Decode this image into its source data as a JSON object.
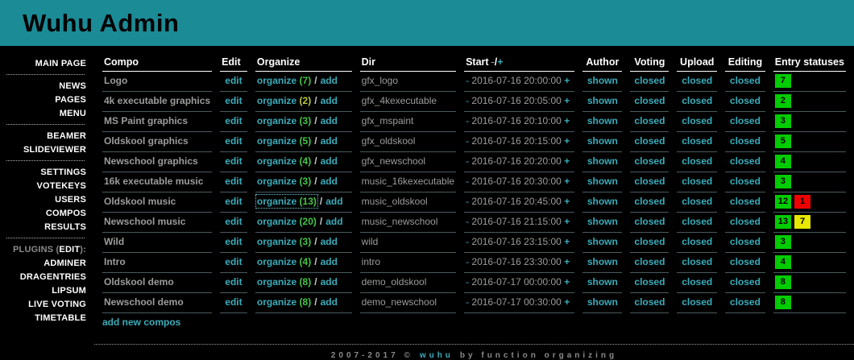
{
  "header": {
    "title": "Wuhu Admin"
  },
  "colors": {
    "header_bg": "#1b8b96",
    "link_teal": "#3aacba",
    "count_green": "#44c544",
    "count_yellow": "#b9c83a",
    "badge_green": "#00cc00",
    "badge_red": "#ee0000",
    "badge_yellow": "#e8e800"
  },
  "sidebar": {
    "items": [
      "MAIN PAGE",
      "NEWS",
      "PAGES",
      "MENU",
      "BEAMER",
      "SLIDEVIEWER",
      "SETTINGS",
      "VOTEKEYS",
      "USERS",
      "COMPOS",
      "RESULTS",
      "ADMINER",
      "DRAGENTRIES",
      "LIPSUM",
      "LIVE VOTING",
      "TIMETABLE"
    ],
    "plugins_prefix": "PLUGINS (",
    "plugins_edit": "EDIT",
    "plugins_suffix": "):"
  },
  "labels": {
    "edit": "edit",
    "organize": "organize",
    "add": "add",
    "slash": "/",
    "minus": "-",
    "plus": "+"
  },
  "table": {
    "headers": {
      "compo": "Compo",
      "edit": "Edit",
      "organize": "Organize",
      "dir": "Dir",
      "start": "Start",
      "start_minus": "-",
      "start_slash": "/",
      "start_plus": "+",
      "author": "Author",
      "voting": "Voting",
      "upload": "Upload",
      "editing": "Editing",
      "entry_statuses": "Entry statuses"
    },
    "add_new": "add new compos",
    "rows": [
      {
        "compo": "Logo",
        "count": "(7)",
        "count_color": "#44c544",
        "dir": "gfx_logo",
        "start": "2016-07-16 20:00:00",
        "author": "shown",
        "voting": "closed",
        "upload": "closed",
        "editing": "closed",
        "badges": [
          {
            "value": "7",
            "color": "#00cc00"
          }
        ]
      },
      {
        "compo": "4k executable graphics",
        "count": "(2)",
        "count_color": "#b9c83a",
        "dir": "gfx_4kexecutable",
        "start": "2016-07-16 20:05:00",
        "author": "shown",
        "voting": "closed",
        "upload": "closed",
        "editing": "closed",
        "badges": [
          {
            "value": "2",
            "color": "#00cc00"
          }
        ]
      },
      {
        "compo": "MS Paint graphics",
        "count": "(3)",
        "count_color": "#44c544",
        "dir": "gfx_mspaint",
        "start": "2016-07-16 20:10:00",
        "author": "shown",
        "voting": "closed",
        "upload": "closed",
        "editing": "closed",
        "badges": [
          {
            "value": "3",
            "color": "#00cc00"
          }
        ]
      },
      {
        "compo": "Oldskool graphics",
        "count": "(5)",
        "count_color": "#44c544",
        "dir": "gfx_oldskool",
        "start": "2016-07-16 20:15:00",
        "author": "shown",
        "voting": "closed",
        "upload": "closed",
        "editing": "closed",
        "badges": [
          {
            "value": "5",
            "color": "#00cc00"
          }
        ]
      },
      {
        "compo": "Newschool graphics",
        "count": "(4)",
        "count_color": "#44c544",
        "dir": "gfx_newschool",
        "start": "2016-07-16 20:20:00",
        "author": "shown",
        "voting": "closed",
        "upload": "closed",
        "editing": "closed",
        "badges": [
          {
            "value": "4",
            "color": "#00cc00"
          }
        ]
      },
      {
        "compo": "16k executable music",
        "count": "(3)",
        "count_color": "#44c544",
        "dir": "music_16kexecutable",
        "start": "2016-07-16 20:30:00",
        "author": "shown",
        "voting": "closed",
        "upload": "closed",
        "editing": "closed",
        "badges": [
          {
            "value": "3",
            "color": "#00cc00"
          }
        ]
      },
      {
        "compo": "Oldskool music",
        "count": "(13)",
        "count_color": "#44c544",
        "organize_focused": true,
        "dir": "music_oldskool",
        "start": "2016-07-16 20:45:00",
        "author": "shown",
        "voting": "closed",
        "upload": "closed",
        "editing": "closed",
        "badges": [
          {
            "value": "12",
            "color": "#00cc00"
          },
          {
            "value": "1",
            "color": "#ee0000"
          }
        ]
      },
      {
        "compo": "Newschool music",
        "count": "(20)",
        "count_color": "#44c544",
        "dir": "music_newschool",
        "start": "2016-07-16 21:15:00",
        "author": "shown",
        "voting": "closed",
        "upload": "closed",
        "editing": "closed",
        "badges": [
          {
            "value": "13",
            "color": "#00cc00"
          },
          {
            "value": "7",
            "color": "#e8e800"
          }
        ]
      },
      {
        "compo": "Wild",
        "count": "(3)",
        "count_color": "#44c544",
        "dir": "wild",
        "start": "2016-07-16 23:15:00",
        "author": "shown",
        "voting": "closed",
        "upload": "closed",
        "editing": "closed",
        "badges": [
          {
            "value": "3",
            "color": "#00cc00"
          }
        ]
      },
      {
        "compo": "Intro",
        "count": "(4)",
        "count_color": "#44c544",
        "dir": "intro",
        "start": "2016-07-16 23:30:00",
        "author": "shown",
        "voting": "closed",
        "upload": "closed",
        "editing": "closed",
        "badges": [
          {
            "value": "4",
            "color": "#00cc00"
          }
        ]
      },
      {
        "compo": "Oldskool demo",
        "count": "(8)",
        "count_color": "#44c544",
        "dir": "demo_oldskool",
        "start": "2016-07-17 00:00:00",
        "author": "shown",
        "voting": "closed",
        "upload": "closed",
        "editing": "closed",
        "badges": [
          {
            "value": "8",
            "color": "#00cc00"
          }
        ]
      },
      {
        "compo": "Newschool demo",
        "count": "(8)",
        "count_color": "#44c544",
        "dir": "demo_newschool",
        "start": "2016-07-17 00:30:00",
        "author": "shown",
        "voting": "closed",
        "upload": "closed",
        "editing": "closed",
        "badges": [
          {
            "value": "8",
            "color": "#00cc00"
          }
        ]
      }
    ]
  },
  "footer": {
    "copyright": "2007-2017 ©",
    "brand": "wuhu",
    "tagline": "by function organizing"
  }
}
